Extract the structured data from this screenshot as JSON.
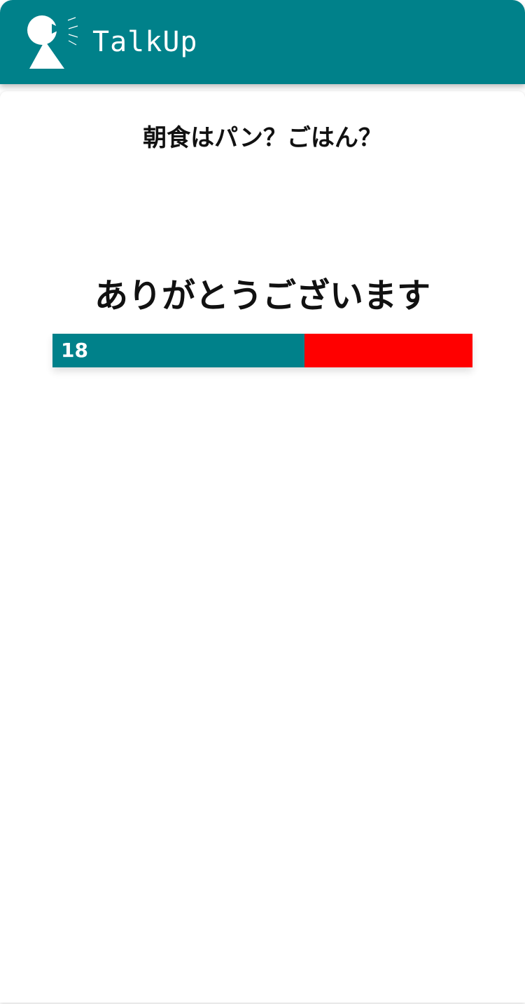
{
  "app": {
    "brand": "TalkUp",
    "logo_icon": "talking-person-icon",
    "accent_color": "#00818a"
  },
  "poll": {
    "question": "朝食はパン？ごはん？",
    "thanks_message": "ありがとうございます",
    "result": {
      "first_option_count": "18",
      "first_option_share": 0.6,
      "first_option_color": "#00818a",
      "second_option_color": "#ff0000"
    }
  }
}
